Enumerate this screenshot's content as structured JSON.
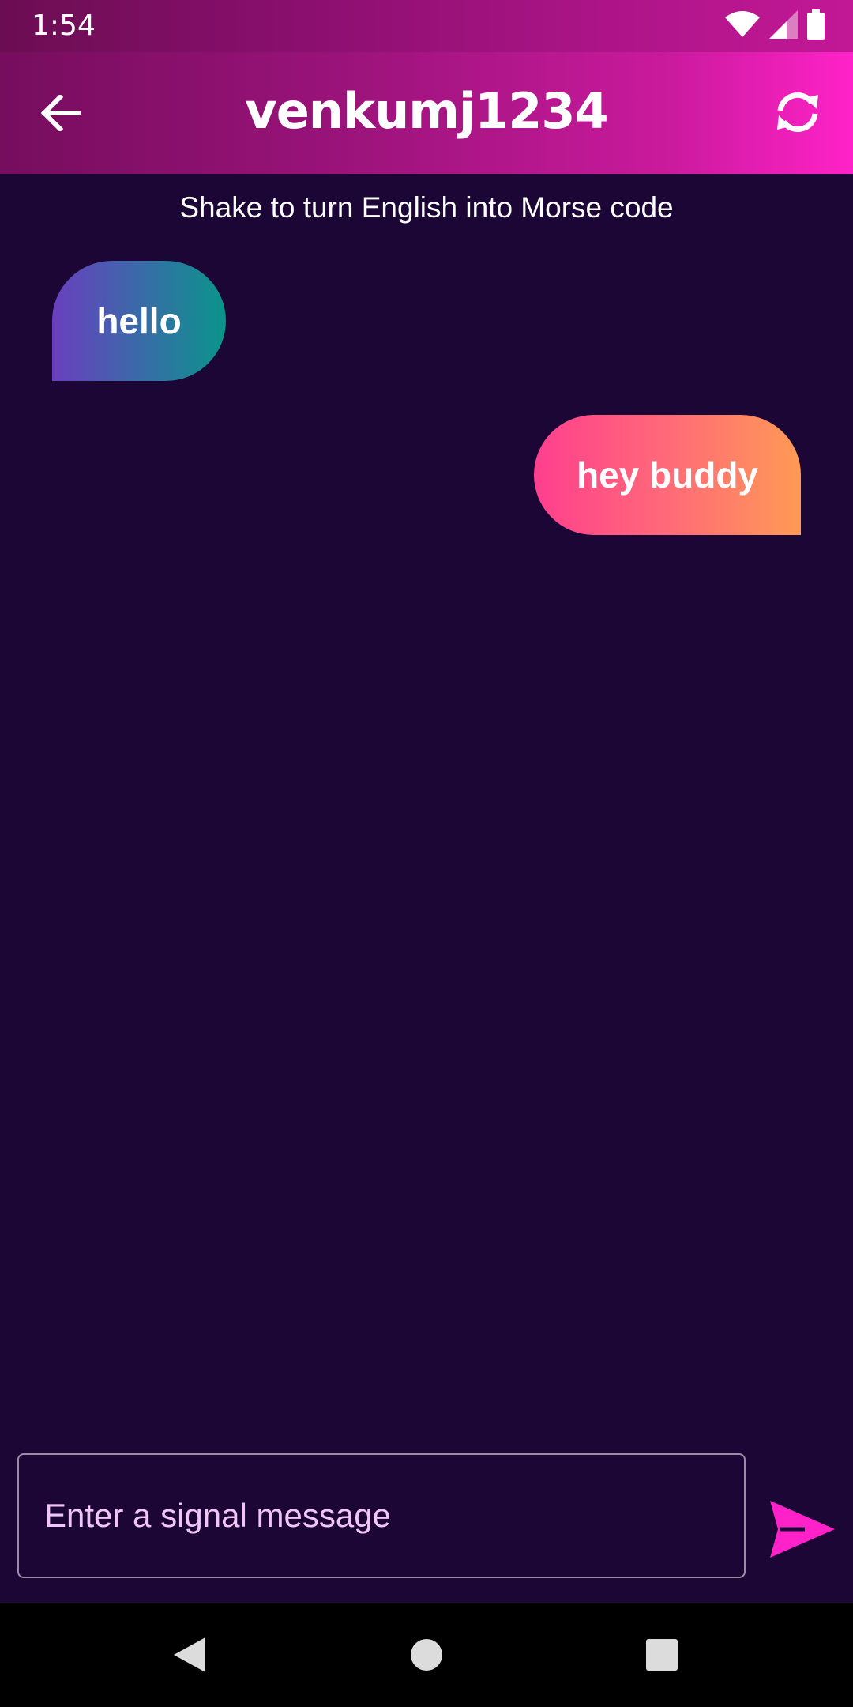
{
  "status_bar": {
    "time": "1:54",
    "icons": [
      "wifi-icon",
      "cellular-signal-icon",
      "battery-icon"
    ]
  },
  "app_bar": {
    "title": "venkumj1234",
    "back_icon": "arrow-back-icon",
    "refresh_icon": "refresh-icon"
  },
  "hint": "Shake to turn English into Morse code",
  "messages": [
    {
      "direction": "incoming",
      "text": "hello"
    },
    {
      "direction": "outgoing",
      "text": "hey buddy"
    }
  ],
  "composer": {
    "placeholder": "Enter a signal message",
    "send_icon": "send-icon"
  },
  "nav_bar": {
    "icons": [
      "nav-back-icon",
      "nav-home-icon",
      "nav-recents-icon"
    ]
  },
  "colors": {
    "background": "#1c0636",
    "accent": "#ff22c8",
    "incoming_bubble_start": "#6a3fbf",
    "incoming_bubble_end": "#0a958a",
    "outgoing_bubble_start": "#ff3f8e",
    "outgoing_bubble_end": "#ff9a55",
    "placeholder": "#f1c5f5"
  }
}
